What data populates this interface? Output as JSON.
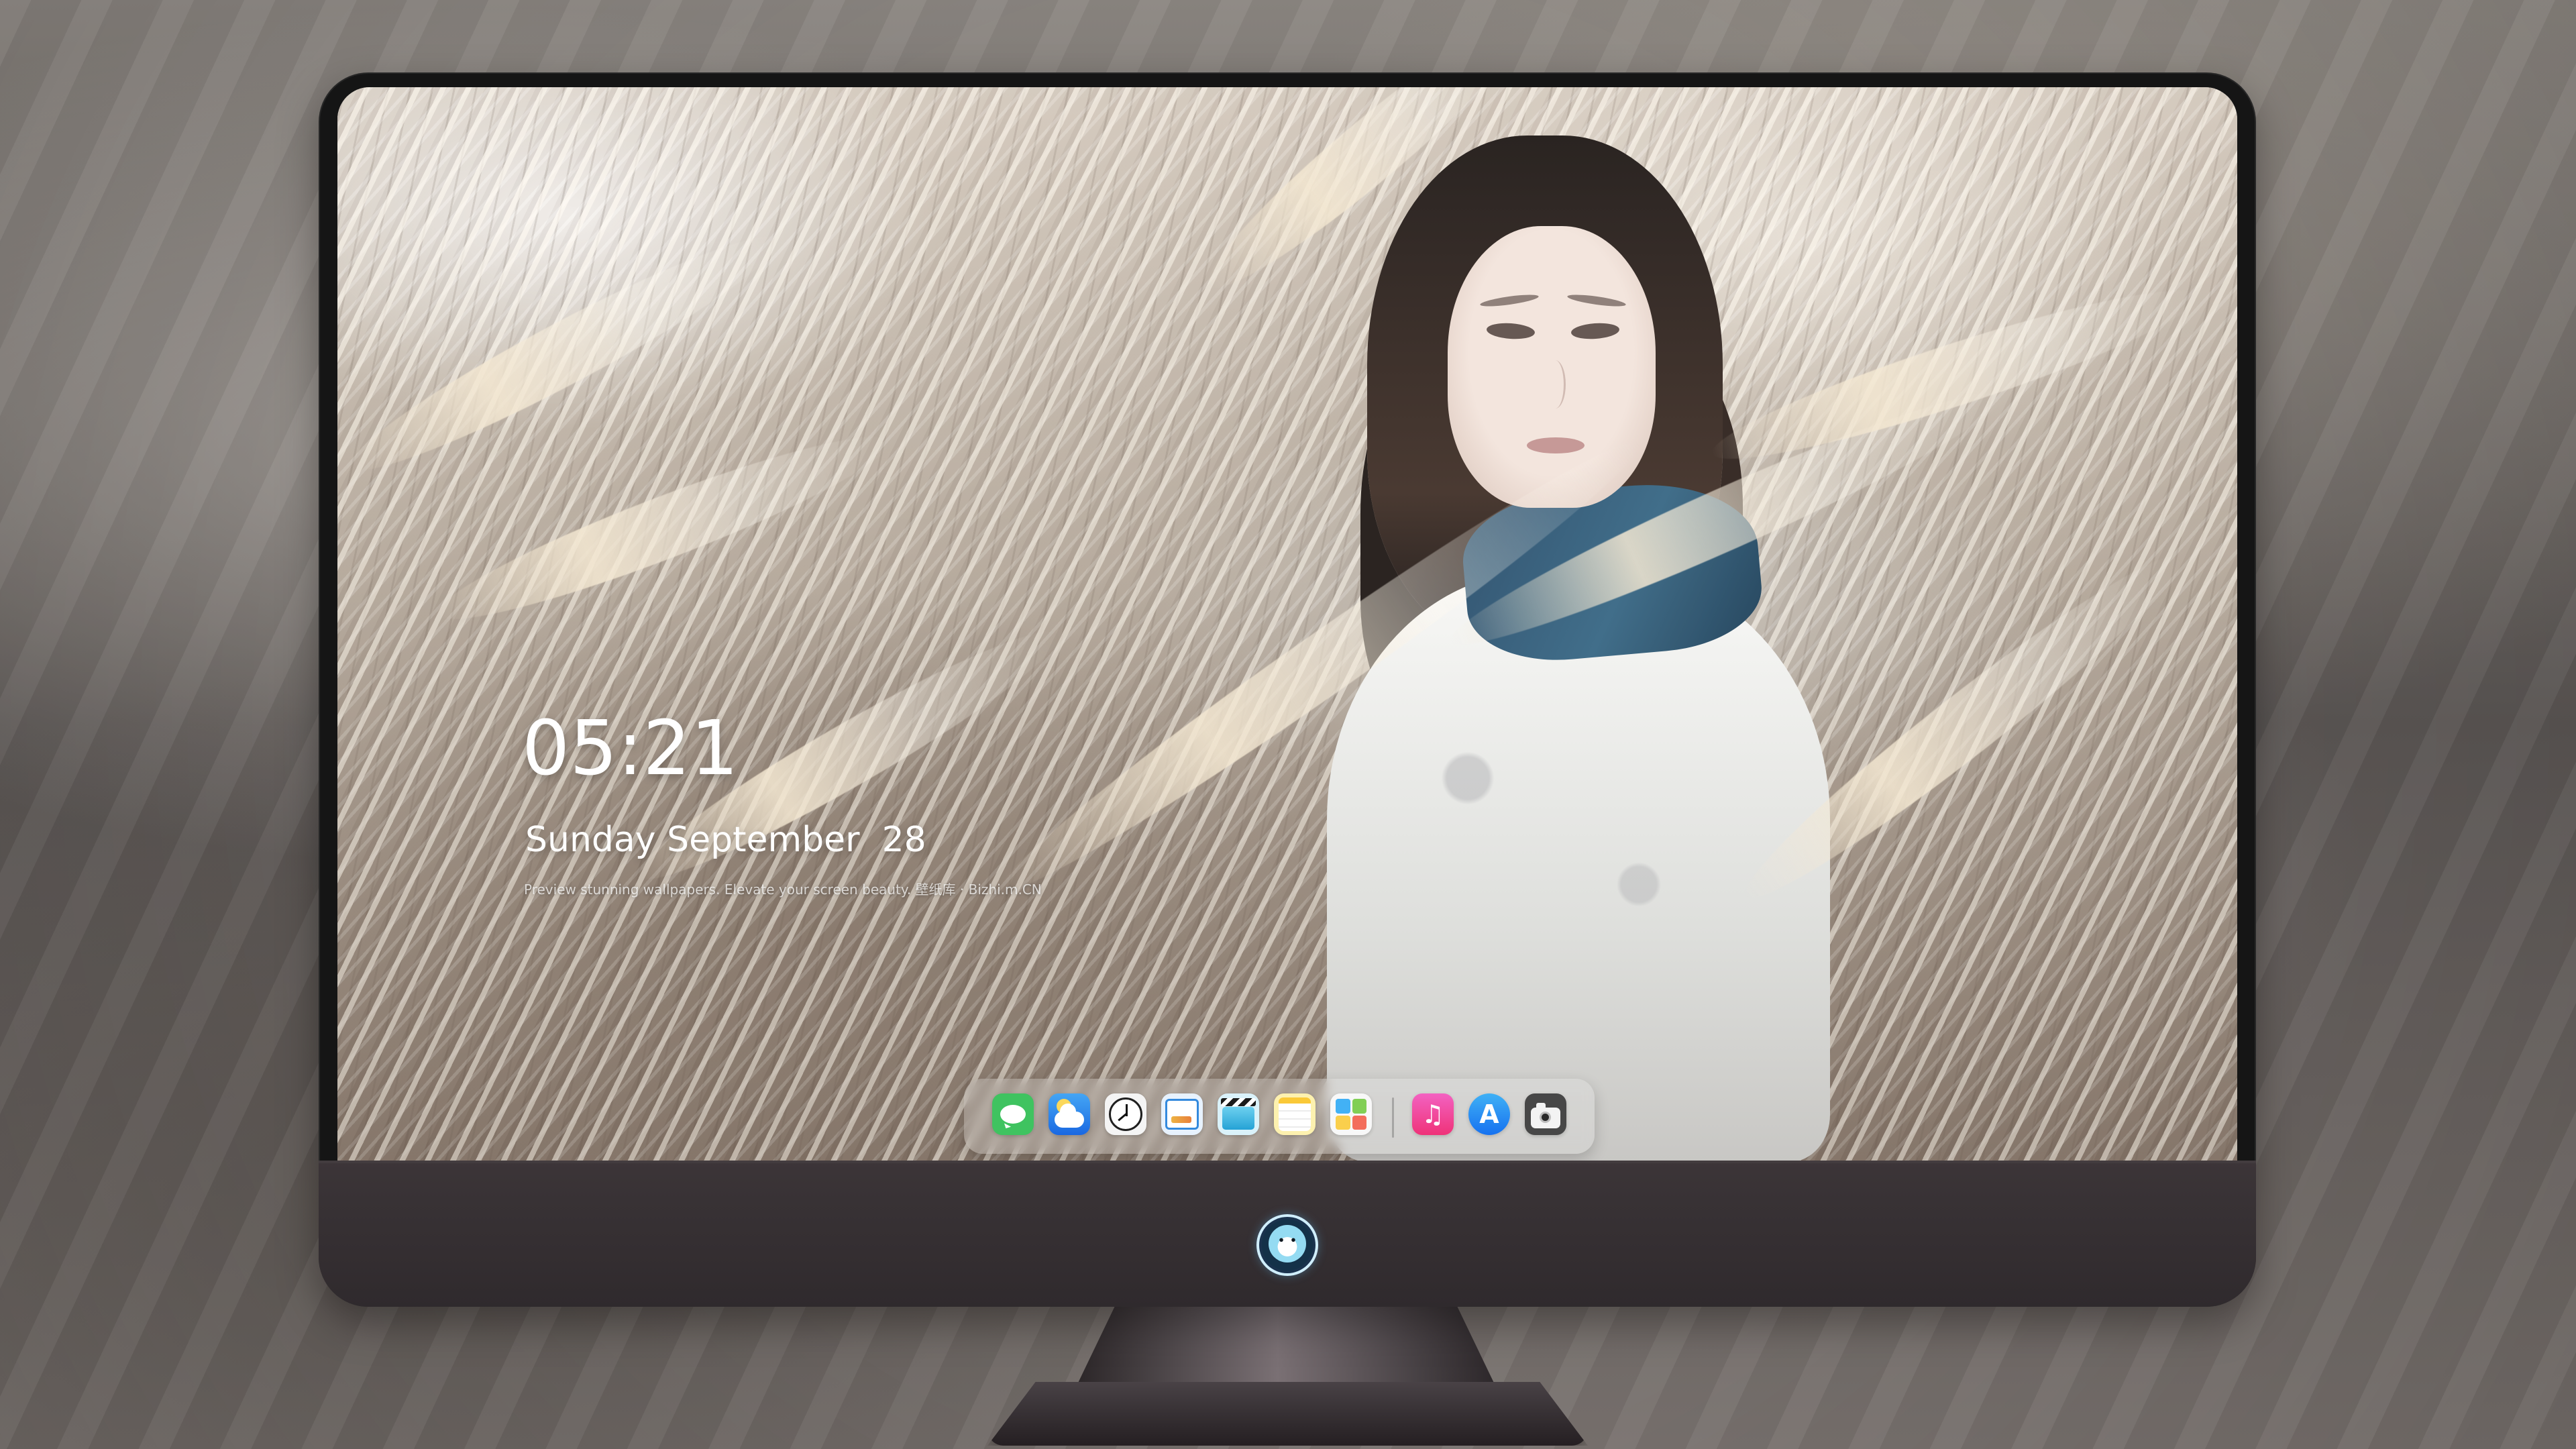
{
  "lock_screen": {
    "time": "05:21",
    "date": "Sunday September  28",
    "caption": "Preview stunning wallpapers. Elevate your screen beauty. 壁纸库 · Bizhi.m.CN"
  },
  "dock": {
    "items": [
      {
        "name": "messages",
        "icon": "message-bubble-icon",
        "color": "#34c759"
      },
      {
        "name": "weather",
        "icon": "weather-cloud-icon",
        "color": "#2f8cff"
      },
      {
        "name": "clock",
        "icon": "clock-icon",
        "color": "#f4f4f4"
      },
      {
        "name": "preview",
        "icon": "preview-image-icon",
        "color": "#e6f2ff"
      },
      {
        "name": "movie",
        "icon": "clapperboard-icon",
        "color": "#30b9ef"
      },
      {
        "name": "notes",
        "icon": "notes-icon",
        "color": "#fff1a8"
      },
      {
        "name": "photos",
        "icon": "photo-grid-icon",
        "color": "#f8f8f8"
      },
      {
        "name": "music",
        "icon": "music-note-icon",
        "color": "#ff4ba5",
        "glyph": "♫"
      },
      {
        "name": "app-store",
        "icon": "app-store-icon",
        "color": "#1992ff",
        "glyph": "A"
      },
      {
        "name": "camera",
        "icon": "camera-icon",
        "color": "#474747"
      }
    ]
  },
  "colors": {
    "monitor_bezel": "#151515",
    "lower_bezel": "#3d3538",
    "dock_background": "rgba(235,235,235,.25)",
    "text": "#ffffff"
  }
}
